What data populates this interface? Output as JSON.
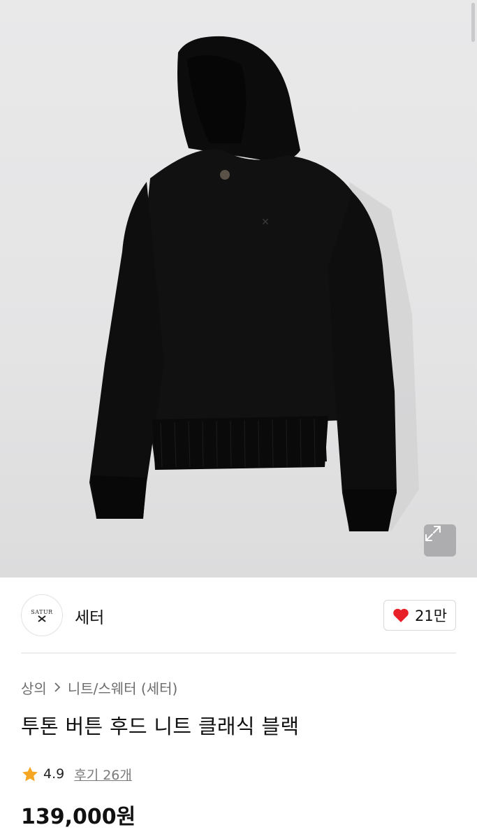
{
  "product_image": {
    "alt": ""
  },
  "brand": {
    "name": "세터",
    "logo_text": "SATUR"
  },
  "like": {
    "count": "21만"
  },
  "breadcrumb": {
    "category": "상의",
    "separator": ">",
    "subcategory": "니트/스웨터 (세터)"
  },
  "product": {
    "title": "투톤 버튼 후드 니트 클래식 블랙",
    "rating": "4.9",
    "reviews": "후기 26개",
    "price": "139,000원"
  },
  "colors": {
    "heart": "#e8202a",
    "star": "#f5a623",
    "background": "#e6e6e7"
  },
  "icons": {
    "expand": "expand-arrows-icon",
    "heart": "heart-icon",
    "star": "star-icon",
    "chevron": "chevron-right-icon"
  }
}
